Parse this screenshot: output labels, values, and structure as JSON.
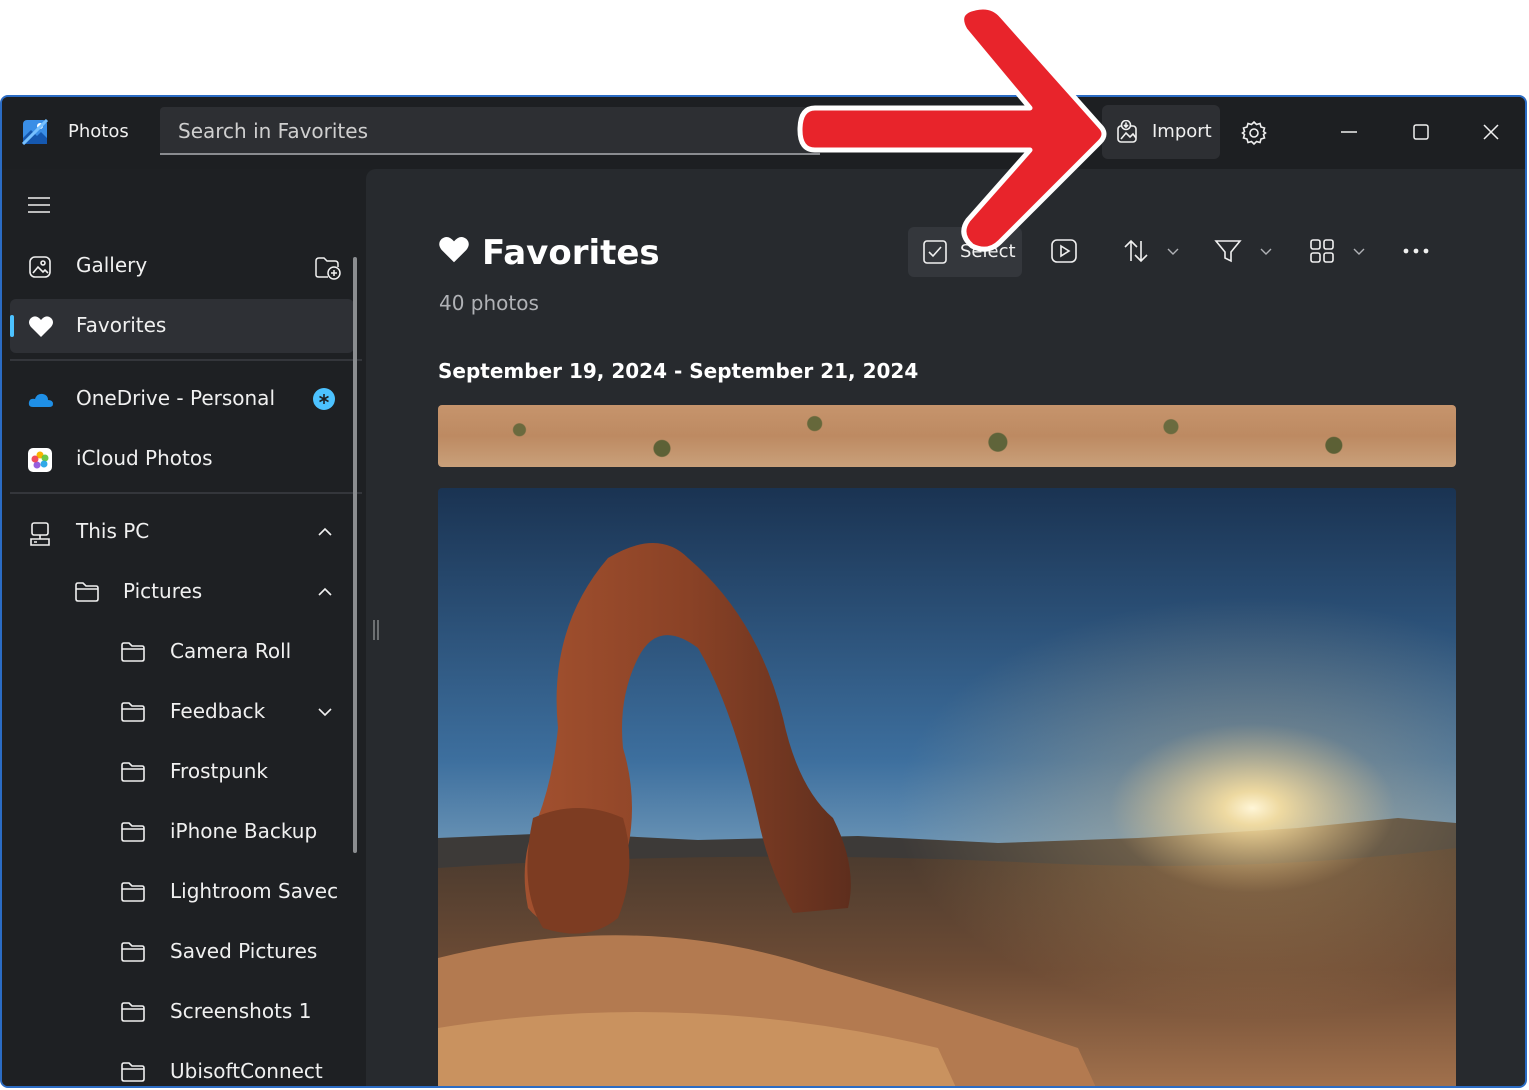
{
  "app": {
    "name": "Photos"
  },
  "search": {
    "placeholder": "Search in Favorites"
  },
  "titlebar": {
    "import_label": "Import"
  },
  "sidebar": {
    "gallery": "Gallery",
    "favorites": "Favorites",
    "onedrive": "OneDrive - Personal",
    "icloud": "iCloud Photos",
    "this_pc": "This PC",
    "pictures": "Pictures",
    "folders": [
      "Camera Roll",
      "Feedback",
      "Frostpunk",
      "iPhone Backup",
      "Lightroom Savec",
      "Saved Pictures",
      "Screenshots 1",
      "UbisoftConnect"
    ]
  },
  "main": {
    "title": "Favorites",
    "count": "40 photos",
    "date_range": "September 19, 2024 - September 21, 2024",
    "select_label": "Select"
  },
  "colors": {
    "accent": "#4cc2ff",
    "arrow": "#e8242b",
    "window_border": "#2b6cc4"
  }
}
